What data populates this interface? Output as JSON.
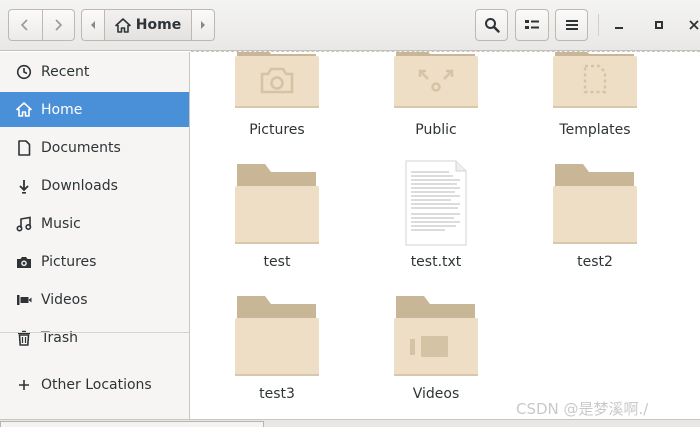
{
  "header": {
    "back_icon": "chevron-left-icon",
    "forward_icon": "chevron-right-icon",
    "path_current": "Home",
    "path_icon": "home-icon",
    "search_icon": "search-icon",
    "view_icon": "list-view-icon",
    "menu_icon": "hamburger-menu-icon",
    "minimize_icon": "minimize-icon",
    "maximize_icon": "maximize-icon",
    "close_icon": "close-icon"
  },
  "sidebar": {
    "items": [
      {
        "label": "Recent",
        "icon": "clock-icon"
      },
      {
        "label": "Home",
        "icon": "home-icon",
        "active": true
      },
      {
        "label": "Documents",
        "icon": "document-icon"
      },
      {
        "label": "Downloads",
        "icon": "download-icon"
      },
      {
        "label": "Music",
        "icon": "music-icon"
      },
      {
        "label": "Pictures",
        "icon": "camera-icon"
      },
      {
        "label": "Videos",
        "icon": "video-icon"
      },
      {
        "label": "Trash",
        "icon": "trash-icon"
      }
    ],
    "other": {
      "label": "Other Locations",
      "icon": "plus-icon"
    }
  },
  "files": [
    {
      "name": "Pictures",
      "kind": "folder",
      "emblem": "camera"
    },
    {
      "name": "Public",
      "kind": "folder",
      "emblem": "share"
    },
    {
      "name": "Templates",
      "kind": "folder",
      "emblem": "template"
    },
    {
      "name": "test",
      "kind": "folder",
      "emblem": "none"
    },
    {
      "name": "test.txt",
      "kind": "text-file",
      "emblem": "none"
    },
    {
      "name": "test2",
      "kind": "folder",
      "emblem": "none"
    },
    {
      "name": "test3",
      "kind": "folder",
      "emblem": "none"
    },
    {
      "name": "Videos",
      "kind": "folder",
      "emblem": "video"
    }
  ],
  "colors": {
    "accent": "#4a90d9",
    "folder_back": "#c9b79a",
    "folder_front": "#eedfc6"
  },
  "watermark": "CSDN @是梦溪啊./"
}
